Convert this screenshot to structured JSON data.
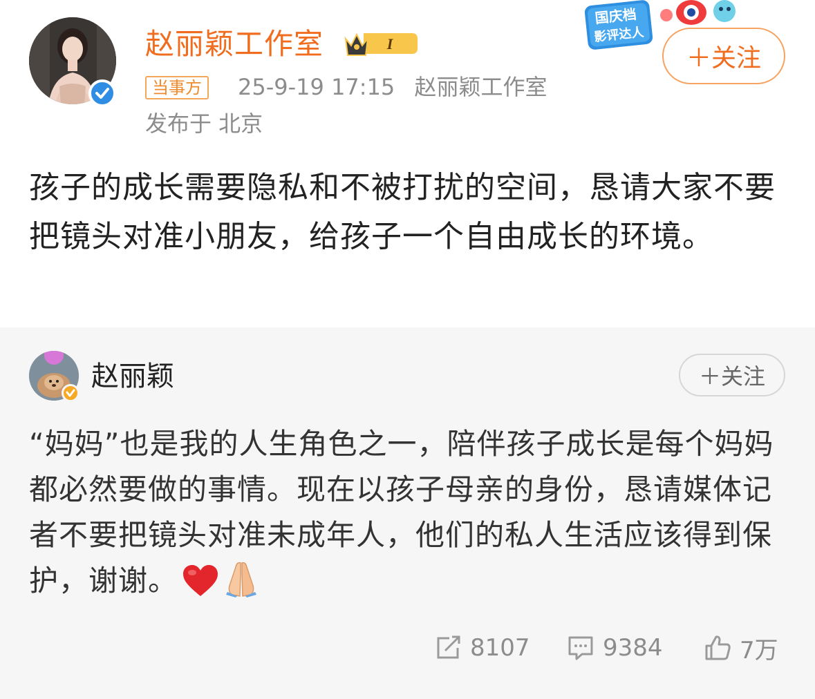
{
  "post": {
    "author_name": "赵丽颖工作室",
    "level_badge": "I",
    "promo_line1": "国庆档",
    "promo_line2": "影评达人",
    "follow_label": "＋关注",
    "source_tag": "当事方",
    "timestamp": "25-9-19 17:15",
    "source_name": "赵丽颖工作室",
    "location": "发布于 北京",
    "text": "孩子的成长需要隐私和不被打扰的空间，恳请大家不要把镜头对准小朋友，给孩子一个自由成长的环境。"
  },
  "quote": {
    "author_name": "赵丽颖",
    "follow_label": "＋关注",
    "text": "“妈妈”也是我的人生角色之一，陪伴孩子成长是每个妈妈都必然要做的事情。现在以孩子母亲的身份，恳请媒体记者不要把镜头对准未成年人，他们的私人生活应该得到保护，谢谢。",
    "emojis": [
      "red-heart",
      "folded-hands"
    ],
    "repost_count": "8107",
    "comment_count": "9384",
    "like_count": "7万"
  },
  "colors": {
    "brand_orange": "#f06d1f",
    "verify_blue": "#2f8de4",
    "verify_gold": "#f7a824",
    "quote_bg": "#f6f6f6"
  }
}
